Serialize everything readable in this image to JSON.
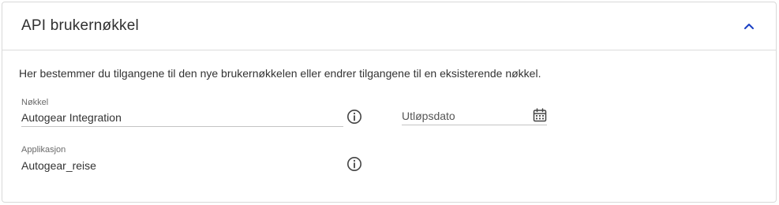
{
  "panel": {
    "title": "API brukernøkkel",
    "collapse_icon": "chevron-up-icon",
    "accent_color": "#1a3fc4"
  },
  "description": "Her bestemmer du tilgangene til den nye brukernøkkelen eller endrer tilgangene til en eksisterende nøkkel.",
  "fields": {
    "key": {
      "label": "Nøkkel",
      "value": "Autogear Integration",
      "icon": "info-icon"
    },
    "expiry": {
      "placeholder": "Utløpsdato",
      "icon": "calendar-icon"
    },
    "application": {
      "label": "Applikasjon",
      "value": "Autogear_reise",
      "icon": "info-icon"
    }
  }
}
